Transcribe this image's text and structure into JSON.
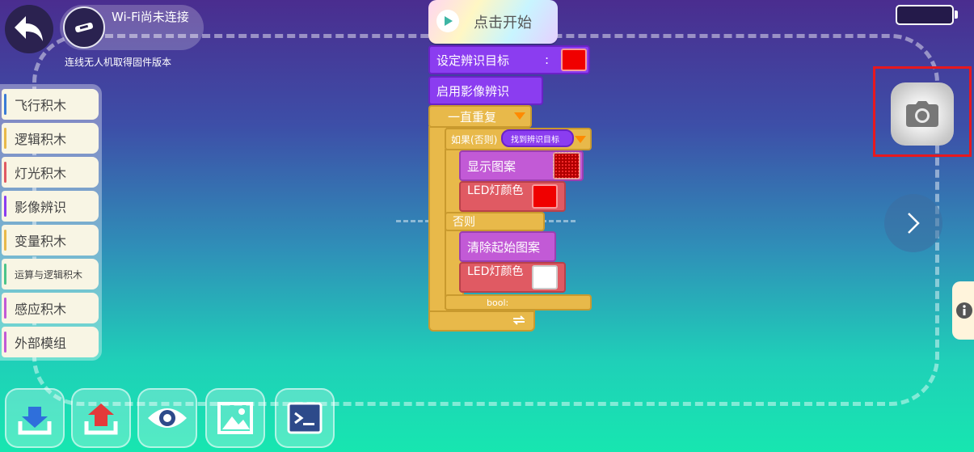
{
  "header": {
    "wifi_status": "Wi-Fi尚未连接",
    "firmware_hint": "连线无人机取得固件版本"
  },
  "palette": {
    "items": [
      {
        "label": "飞行积木",
        "color": "#3a7bd5"
      },
      {
        "label": "逻辑积木",
        "color": "#e8b94a"
      },
      {
        "label": "灯光积木",
        "color": "#e05a63"
      },
      {
        "label": "影像辨识",
        "color": "#8b3df0"
      },
      {
        "label": "变量积木",
        "color": "#e8b94a"
      },
      {
        "label": "运算与逻辑积木",
        "color": "#4cc48a"
      },
      {
        "label": "感应积木",
        "color": "#c25ad6"
      },
      {
        "label": "外部模组",
        "color": "#c25ad6"
      }
    ]
  },
  "program": {
    "start_label": "点击开始",
    "set_target_label": "设定辨识目标",
    "set_target_colon": ":",
    "enable_vision_label": "启用影像辨识",
    "forever_label": "一直重复",
    "if_label": "如果(否则)",
    "condition_label": "找到辨识目标",
    "show_pattern_label": "显示图案",
    "led_color_label_1": "LED灯颜色",
    "else_label": "否则",
    "clear_pattern_label": "清除起始图案",
    "led_color_label_2": "LED灯颜色",
    "bool_label": "bool:",
    "target_color": "#f00000",
    "led_color_1": "#f00000",
    "led_color_2": "#ffffff"
  },
  "icons": {
    "back": "back-arrow-icon",
    "camera": "camera-icon",
    "next": "chevron-right-icon",
    "info": "info-icon",
    "download": "download-icon",
    "upload": "upload-icon",
    "preview": "eye-icon",
    "gallery": "image-icon",
    "console": "terminal-icon"
  }
}
